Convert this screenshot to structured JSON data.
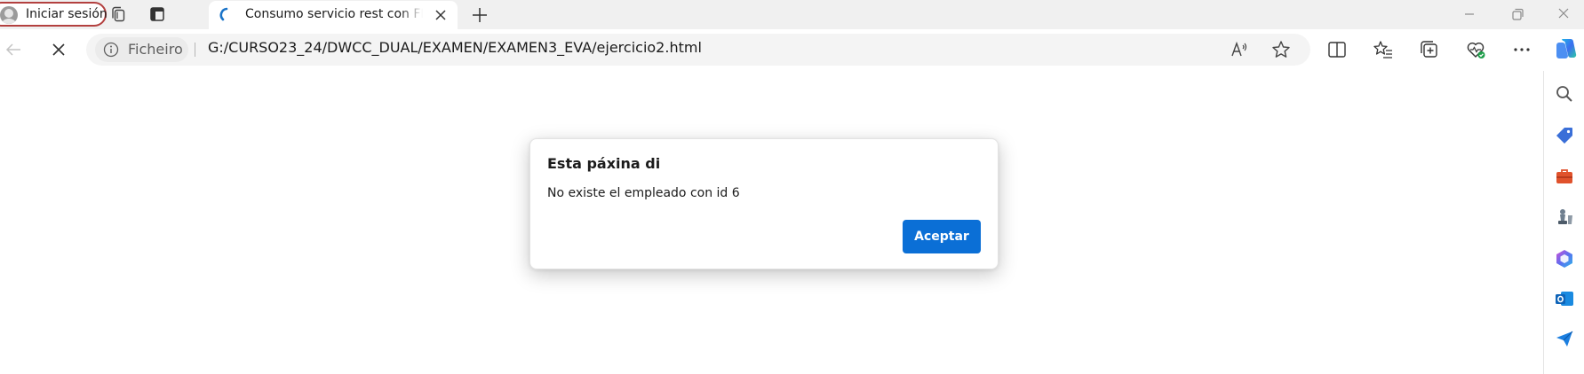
{
  "tabstrip": {
    "profile_label": "Iniciar sesión",
    "tab_title": "Consumo servicio rest con FECTH",
    "icons": [
      "person-avatar-icon",
      "workspaces-icon",
      "tab-actions-icon",
      "loading-spinner-icon",
      "close-icon",
      "plus-icon",
      "minimize-icon",
      "restore-icon",
      "window-close-icon"
    ]
  },
  "toolbar": {
    "site_chip_label": "Ficheiro",
    "url": "G:/CURSO23_24/DWCC_DUAL/EXAMEN/EXAMEN3_EVA/ejercicio2.html",
    "icons": [
      "back-arrow-icon",
      "stop-loading-icon",
      "info-icon",
      "read-aloud-icon",
      "favorite-star-icon",
      "split-screen-icon",
      "favorites-icon",
      "collections-icon",
      "browser-essentials-icon",
      "more-dots-icon",
      "copilot-icon"
    ]
  },
  "sidebar": {
    "icons": [
      "search-icon",
      "shopping-tag-icon",
      "tools-briefcase-icon",
      "games-chess-icon",
      "microsoft-365-icon",
      "outlook-icon",
      "send-icon"
    ]
  },
  "dialog": {
    "title": "Esta páxina di",
    "message": "No existe el empleado con id 6",
    "ok_label": "Aceptar"
  },
  "colors": {
    "accent": "#0b6fd6",
    "profile_border": "#b3403f",
    "tabstrip_bg": "#f0f0f0",
    "omnibox_bg": "#f4f4f4"
  }
}
